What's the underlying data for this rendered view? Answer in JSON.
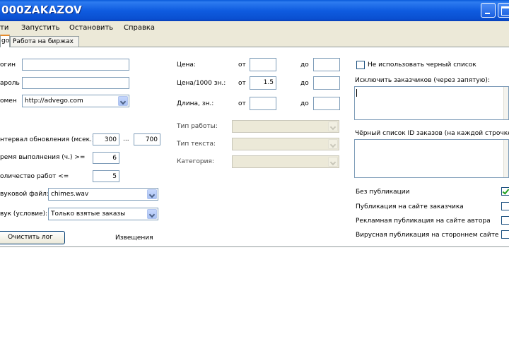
{
  "window": {
    "title": "000ZAKAZOV"
  },
  "menu": {
    "items": [
      "ти",
      "Запустить",
      "Остановить",
      "Справка"
    ]
  },
  "tabs": [
    "go",
    "Работа на биржах"
  ],
  "left": {
    "login_label": "огин",
    "login_value": "",
    "password_label": "ароль",
    "password_value": "",
    "domain_label": "омен",
    "domain_value": "http://advego.com",
    "interval_label": "нтервал обновления (мсек.)",
    "interval_from": "300",
    "interval_sep": "...",
    "interval_to": "700",
    "time_label": "ремя выполнения (ч.) >=",
    "time_value": "6",
    "count_label": "оличество работ <=",
    "count_value": "5",
    "sound_label": "вуковой файл:",
    "sound_value": "chimes.wav",
    "condition_label": "вук (условие):",
    "condition_value": "Только взятые заказы",
    "clear_button": "Очистить лог",
    "notices_label": "Извещения"
  },
  "middle": {
    "price_label": "Цена:",
    "price_per1000_label": "Цена/1000 зн.:",
    "length_label": "Длина, зн.:",
    "from_label": "от",
    "to_label": "до",
    "price_from": "",
    "price_to": "",
    "per1000_from": "1.5",
    "per1000_to": "",
    "length_from": "",
    "length_to": "",
    "work_type_label": "Тип работы:",
    "text_type_label": "Тип текста:",
    "category_label": "Категория:"
  },
  "right": {
    "no_blacklist_label": "Не использовать черный список",
    "no_blacklist_checked": false,
    "exclude_label": "Исключить заказчиков (через запятую):",
    "exclude_value": "",
    "blacklist_label": "Чёрный список ID заказов (на каждой строчке):",
    "blacklist_value": "",
    "options": [
      {
        "label": "Без публикации",
        "checked": true
      },
      {
        "label": "Публикация на сайте заказчика",
        "checked": false
      },
      {
        "label": "Рекламная публикация на сайте автора",
        "checked": false
      },
      {
        "label": "Вирусная публикация на стороннем сайте",
        "checked": false
      }
    ]
  },
  "log": {
    "text": ""
  },
  "colors": {
    "titlebar": "#0a5bdb",
    "window_bg": "#ece9d8",
    "tab_accent": "#e68b2c",
    "check": "#21a121"
  }
}
